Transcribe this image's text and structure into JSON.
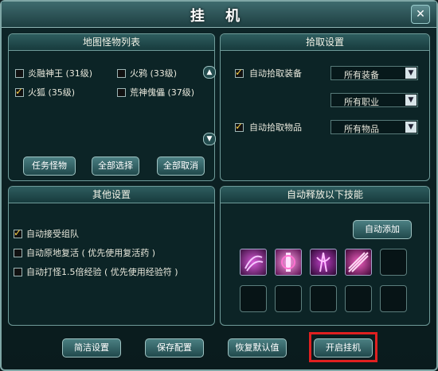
{
  "window": {
    "title": "挂 机",
    "close_glyph": "✕"
  },
  "monsters": {
    "header": "地图怪物列表",
    "items": [
      {
        "label": "炎融神王 (31级)",
        "checked": false
      },
      {
        "label": "火鸦 (33级)",
        "checked": false
      },
      {
        "label": "火狐 (35级)",
        "checked": true
      },
      {
        "label": "荒神傀儡 (37级)",
        "checked": false
      }
    ],
    "buttons": [
      "任务怪物",
      "全部选择",
      "全部取消"
    ]
  },
  "pickup": {
    "header": "拾取设置",
    "equip": {
      "label": "自动拾取装备",
      "checked": true,
      "select1": "所有装备",
      "select2": "所有职业"
    },
    "items": {
      "label": "自动拾取物品",
      "checked": true,
      "select": "所有物品"
    }
  },
  "other": {
    "header": "其他设置",
    "options": [
      {
        "label": "自动接受组队",
        "checked": true
      },
      {
        "label": "自动原地复活 ( 优先使用复活药 )",
        "checked": false
      },
      {
        "label": "自动打怪1.5倍经验 ( 优先使用经验符 )",
        "checked": false
      }
    ]
  },
  "skills": {
    "header": "自动释放以下技能",
    "add_button": "自动添加",
    "icons": [
      "claw-skill-icon",
      "pillar-skill-icon",
      "vortex-skill-icon",
      "slash-skill-icon"
    ]
  },
  "footer": {
    "buttons": [
      "简洁设置",
      "保存配置",
      "恢复默认值",
      "开启挂机"
    ]
  },
  "colors": {
    "check": "#f7d14a",
    "highlight": "#e02020",
    "panel_border": "#6f9b99"
  }
}
